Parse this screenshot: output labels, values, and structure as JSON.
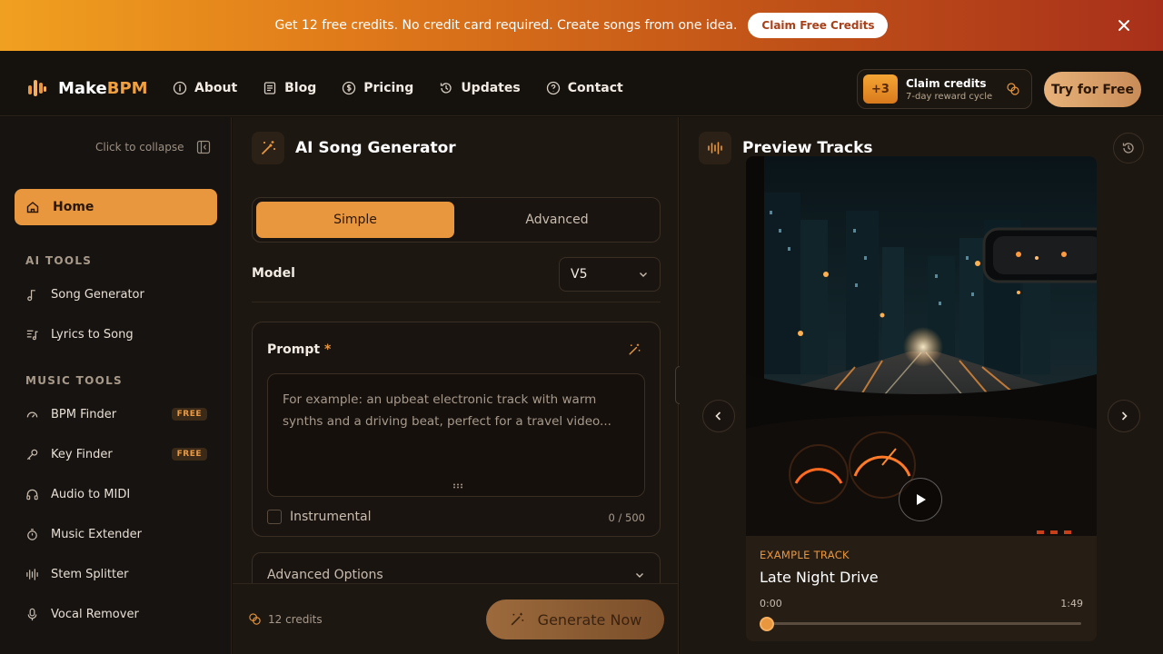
{
  "banner": {
    "text": "Get 12 free credits. No credit card required. Create songs from one idea.",
    "button": "Claim Free Credits"
  },
  "header": {
    "logo_main": "Make",
    "logo_accent": "BPM",
    "nav": [
      "About",
      "Blog",
      "Pricing",
      "Updates",
      "Contact"
    ],
    "claim": {
      "badge": "+3",
      "title": "Claim credits",
      "subtitle": "7-day reward cycle"
    },
    "try_button": "Try for Free"
  },
  "sidebar": {
    "collapse": "Click to collapse",
    "home": "Home",
    "ai_tools_title": "AI TOOLS",
    "ai_tools": [
      "Song Generator",
      "Lyrics to Song"
    ],
    "music_tools_title": "MUSIC TOOLS",
    "music_tools": [
      {
        "label": "BPM Finder",
        "badge": "FREE"
      },
      {
        "label": "Key Finder",
        "badge": "FREE"
      },
      {
        "label": "Audio to MIDI",
        "badge": ""
      },
      {
        "label": "Music Extender",
        "badge": ""
      },
      {
        "label": "Stem Splitter",
        "badge": ""
      },
      {
        "label": "Vocal Remover",
        "badge": ""
      }
    ]
  },
  "generator": {
    "title": "AI Song Generator",
    "tabs": {
      "simple": "Simple",
      "advanced": "Advanced"
    },
    "model_label": "Model",
    "model_value": "V5",
    "prompt_label": "Prompt",
    "required_mark": "*",
    "prompt_placeholder": "For example: an upbeat electronic track with warm synths and a driving beat, perfect for a travel video...",
    "instrumental": "Instrumental",
    "counter": "0 / 500",
    "advanced_options": "Advanced Options",
    "credits": "12 credits",
    "generate": "Generate Now"
  },
  "preview": {
    "title": "Preview Tracks",
    "label": "EXAMPLE TRACK",
    "track_title": "Late Night Drive",
    "time_start": "0:00",
    "time_end": "1:49",
    "progress": 0
  },
  "colors": {
    "accent": "#e9973e",
    "background": "#14100c",
    "panel": "#1d1712"
  }
}
